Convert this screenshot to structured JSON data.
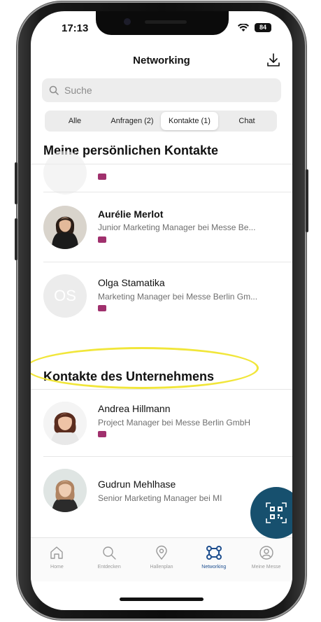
{
  "status_bar": {
    "time": "17:13",
    "battery": "84"
  },
  "header": {
    "title": "Networking"
  },
  "search": {
    "placeholder": "Suche"
  },
  "tabs": [
    {
      "label": "Alle"
    },
    {
      "label": "Anfragen (2)"
    },
    {
      "label": "Kontakte (1)",
      "active": true
    },
    {
      "label": "Chat"
    }
  ],
  "personal_section": {
    "title": "Meine persönlichen Kontakte",
    "contacts": [
      {
        "initials": "",
        "name": "",
        "role": ""
      },
      {
        "name": "Aurélie Merlot",
        "role": "Junior Marketing Manager bei Messe Be..."
      },
      {
        "initials": "OS",
        "name": "Olga Stamatika",
        "role": "Marketing Manager bei Messe Berlin Gm..."
      }
    ]
  },
  "company_section": {
    "title": "Kontakte des Unternehmens",
    "contacts": [
      {
        "name": "Andrea Hillmann",
        "role": "Project Manager bei Messe Berlin GmbH"
      },
      {
        "name": "Gudrun Mehlhase",
        "role": "Senior Marketing Manager bei MI"
      }
    ]
  },
  "tab_bar": [
    {
      "label": "Home",
      "icon": "home-icon"
    },
    {
      "label": "Entdecken",
      "icon": "search-icon"
    },
    {
      "label": "Hallenplan",
      "icon": "map-pin-icon"
    },
    {
      "label": "Networking",
      "icon": "network-icon",
      "active": true
    },
    {
      "label": "Meine Messe",
      "icon": "user-circle-icon"
    }
  ],
  "colors": {
    "accent": "#1e4f8f",
    "fab": "#17506e",
    "tag": "#a0306d",
    "highlight": "#f1e63a"
  }
}
